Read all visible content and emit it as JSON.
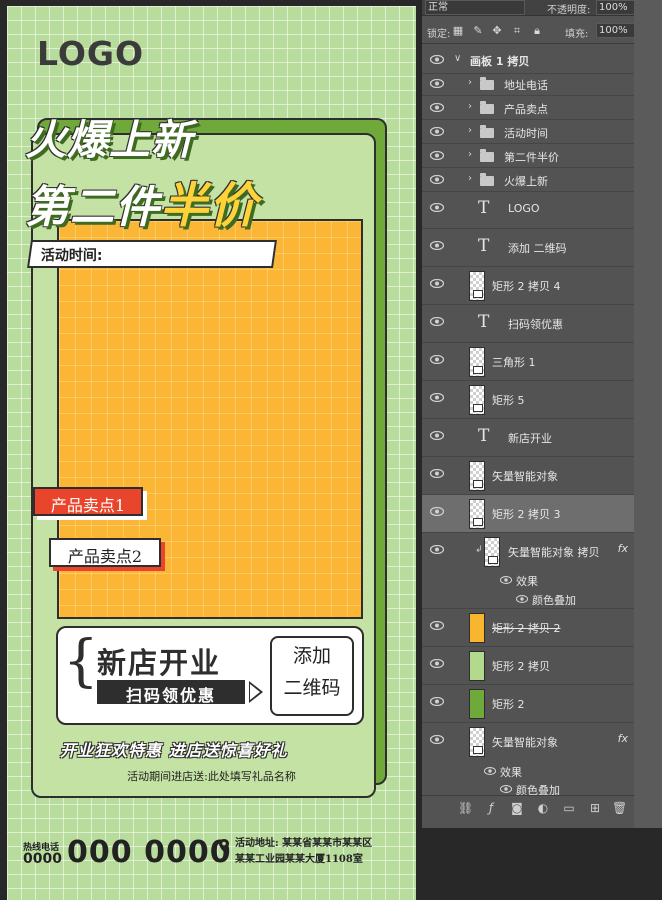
{
  "poster": {
    "logo": "LOGO",
    "headline_line1": "火爆上新",
    "headline_line2_prefix": "第二件",
    "headline_line2_accent": "半价",
    "time_label": "活动时间:",
    "selling_point_1": "产品卖点1",
    "selling_point_2": "产品卖点2",
    "new_shop": "新店开业",
    "scan_text": "扫码领优惠",
    "qr_line1": "添加",
    "qr_line2": "二维码",
    "promo": "开业狂欢特惠   进店送惊喜好礼",
    "gift_line": "活动期间进店送:此处填写礼品名称",
    "hotline_label": "热线电话",
    "hotline_small": "0000",
    "hotline_big": "000 0000",
    "address_line1": "活动地址: 某某省某某市某某区",
    "address_line2": "某某工业园某某大厦1108室",
    "colors": {
      "background": "#b7dc9c",
      "frame_dark": "#6fa93a",
      "yellow": "#fbb636",
      "red": "#e8452c"
    }
  },
  "panel": {
    "blend_mode": "正常",
    "opacity_label": "不透明度:",
    "opacity_value": "100%",
    "lock_label": "锁定:",
    "fill_label": "填充:",
    "fill_value": "100%",
    "lock_icons": [
      "checker-lock-icon",
      "brush-lock-icon",
      "move-lock-icon",
      "artboard-lock-icon",
      "padlock-icon"
    ],
    "layers": [
      {
        "name": "画板 1 拷贝",
        "kind": "artboard"
      },
      {
        "name": "地址电话",
        "kind": "group"
      },
      {
        "name": "产品卖点",
        "kind": "group"
      },
      {
        "name": "活动时间",
        "kind": "group"
      },
      {
        "name": "第二件半价",
        "kind": "group"
      },
      {
        "name": "火爆上新",
        "kind": "group"
      },
      {
        "name": "LOGO",
        "kind": "text"
      },
      {
        "name": "添加 二维码",
        "kind": "text"
      },
      {
        "name": "矩形 2 拷贝 4",
        "kind": "shape"
      },
      {
        "name": "扫码领优惠",
        "kind": "text"
      },
      {
        "name": "三角形 1",
        "kind": "shape"
      },
      {
        "name": "矩形 5",
        "kind": "shape"
      },
      {
        "name": "新店开业",
        "kind": "text"
      },
      {
        "name": "矢量智能对象",
        "kind": "smart"
      },
      {
        "name": "矩形 2 拷贝 3",
        "kind": "shape"
      },
      {
        "name": "矢量智能对象 拷贝",
        "kind": "smart"
      },
      {
        "name": "矩形 2 拷贝 2",
        "kind": "shape"
      },
      {
        "name": "矩形 2 拷贝",
        "kind": "shape"
      },
      {
        "name": "矩形 2",
        "kind": "shape"
      },
      {
        "name": "矢量智能对象",
        "kind": "smart"
      }
    ],
    "effects_label": "效果",
    "color_overlay_label": "颜色叠加",
    "fx_label": "fx"
  }
}
